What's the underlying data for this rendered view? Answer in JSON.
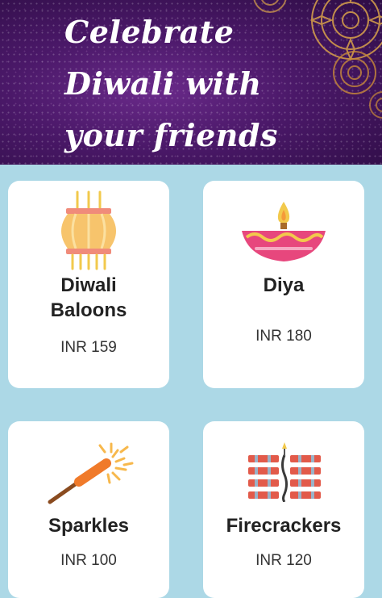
{
  "banner": {
    "title": "Celebrate Diwali with your friends",
    "background_color": "#4a1868",
    "accent_color": "#d9a24a"
  },
  "products": [
    {
      "name": "Diwali Baloons",
      "price": "INR 159",
      "icon": "lantern-icon"
    },
    {
      "name": "Diya",
      "price": "INR 180",
      "icon": "diya-icon"
    },
    {
      "name": "Sparkles",
      "price": "INR 100",
      "icon": "sparkler-icon"
    },
    {
      "name": "Firecrackers",
      "price": "INR 120",
      "icon": "firecracker-icon"
    }
  ],
  "theme": {
    "page_background": "#acd8e6",
    "card_background": "#ffffff"
  }
}
